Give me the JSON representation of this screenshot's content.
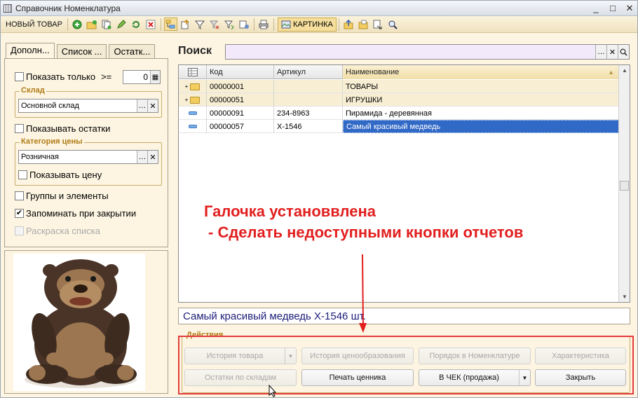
{
  "window": {
    "title": "Справочник Номенклатура",
    "controls": [
      "_",
      "□",
      "✕"
    ]
  },
  "toolbar": {
    "new_label": "НОВЫЙ ТОВАР",
    "card_label": "КАРТИНКА",
    "icons": [
      "add-icon",
      "add-folder-icon",
      "copy-icon",
      "edit-icon",
      "refresh-icon",
      "delete-icon",
      "hierarchy-icon",
      "up-level-icon",
      "filter-icon",
      "clear-filter-icon",
      "filter-history-icon",
      "settings-icon",
      "print-icon",
      "card-icon",
      "folder-up-icon",
      "folder-move-icon",
      "export-icon",
      "find-icon"
    ]
  },
  "left": {
    "tabs": [
      "Дополн...",
      "Список ...",
      "Остатк..."
    ],
    "show_only_label": "Показать только",
    "show_only_op": ">=",
    "show_only_value": "0",
    "warehouse_group": "Склад",
    "warehouse_value": "Основной склад",
    "show_stock_label": "Показывать остатки",
    "price_group": "Категория цены",
    "price_value": "Розничная",
    "show_price_label": "Показывать цену",
    "groups_label": "Группы и элементы",
    "remember_label": "Запоминать при закрытии",
    "coloring_label": "Раскраска списка",
    "remember_checked": true
  },
  "search": {
    "label": "Поиск",
    "value": ""
  },
  "grid": {
    "columns": [
      "Код",
      "Артикул",
      "Наименование"
    ],
    "rows": [
      {
        "type": "group",
        "code": "00000001",
        "article": "",
        "name": "ТОВАРЫ"
      },
      {
        "type": "group",
        "code": "00000051",
        "article": "",
        "name": "ИГРУШКИ"
      },
      {
        "type": "item",
        "code": "00000091",
        "article": "234-8963",
        "name": "Пирамида - деревянная"
      },
      {
        "type": "item",
        "code": "00000057",
        "article": "Х-1546",
        "name": "Самый красивый медведь",
        "selected": true
      }
    ]
  },
  "info": {
    "text": "Самый красивый медведь Х-1546 шт."
  },
  "actions": {
    "title": "Действия",
    "history": "История товара",
    "price_history": "История ценообразования",
    "order": "Порядок в Номенклатуре",
    "characteristic": "Характеристика",
    "stock": "Остатки по складам",
    "print_tag": "Печать ценника",
    "to_receipt": "В ЧЕК (продажа)",
    "close": "Закрыть"
  },
  "annotation": {
    "line1": "Галочка установвлена",
    "line2": "- Сделать недоступными кнопки отчетов",
    "color": "#e21f1f"
  }
}
